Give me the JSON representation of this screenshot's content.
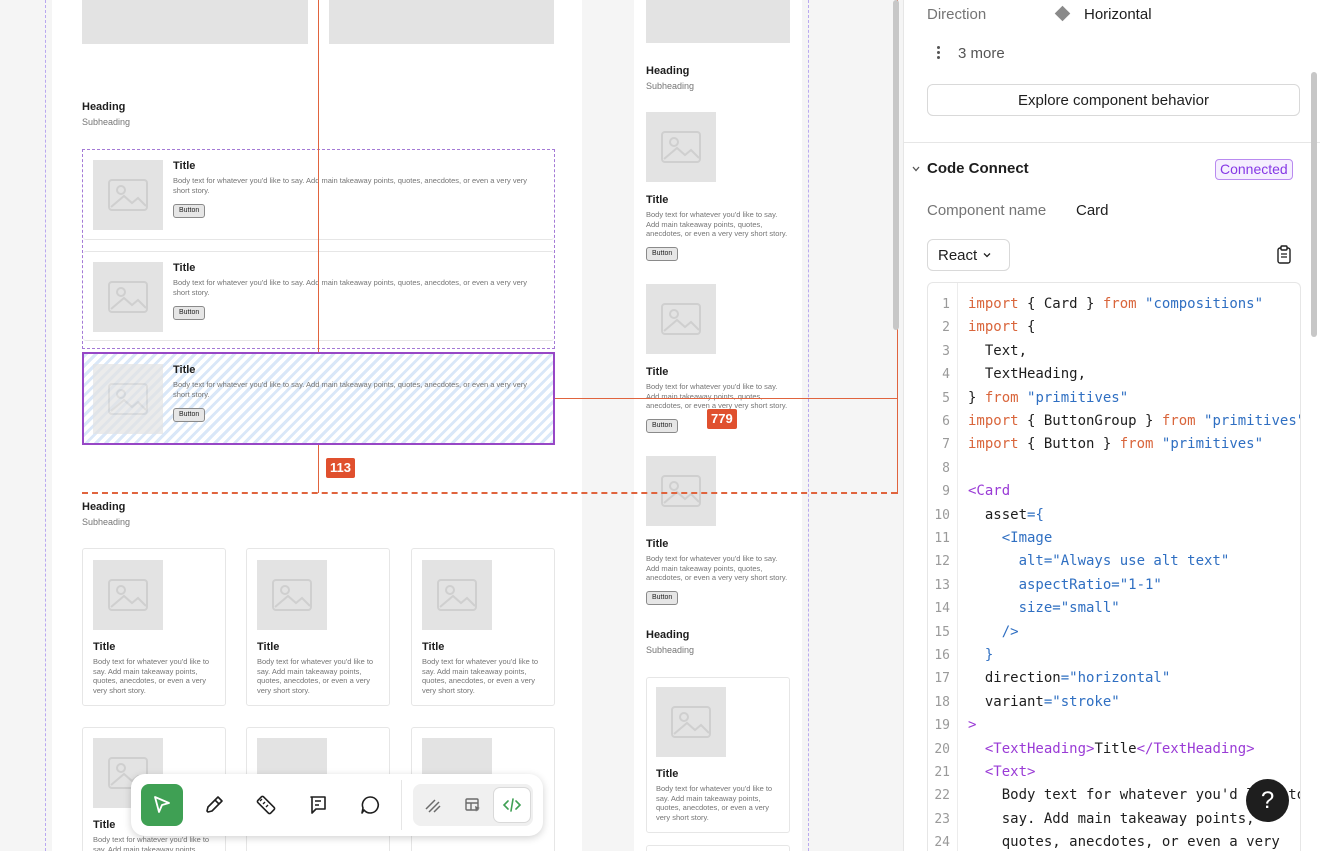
{
  "canvas": {
    "heading": "Heading",
    "subheading": "Subheading",
    "card_title": "Title",
    "card_body": "Body text for whatever you'd like to say. Add main takeaway points, quotes, anecdotes, or even a very very short story.",
    "card_button": "Button",
    "measure_gap": "113",
    "measure_width": "779"
  },
  "toolbar": {
    "tools": [
      "move-tool",
      "pen-tool",
      "measure-tool",
      "annotate-tool",
      "comment-tool"
    ],
    "mode_tools": [
      "draw-mode",
      "design-mode",
      "dev-mode"
    ]
  },
  "panel": {
    "direction_label": "Direction",
    "direction_value": "Horizontal",
    "more_label": "3 more",
    "explore_button": "Explore component behavior",
    "section_title": "Code Connect",
    "status_badge": "Connected",
    "component_name_label": "Component name",
    "component_name_value": "Card",
    "framework": "React",
    "code_lines": [
      [
        {
          "t": "import",
          "c": "kw"
        },
        {
          "t": " { Card } ",
          "c": "p"
        },
        {
          "t": "from",
          "c": "kw"
        },
        {
          "t": " ",
          "c": "p"
        },
        {
          "t": "\"compositions\"",
          "c": "str"
        }
      ],
      [
        {
          "t": "import",
          "c": "kw"
        },
        {
          "t": " {",
          "c": "p"
        }
      ],
      [
        {
          "t": "  Text,",
          "c": "p"
        }
      ],
      [
        {
          "t": "  TextHeading,",
          "c": "p"
        }
      ],
      [
        {
          "t": "} ",
          "c": "p"
        },
        {
          "t": "from",
          "c": "kw"
        },
        {
          "t": " ",
          "c": "p"
        },
        {
          "t": "\"primitives\"",
          "c": "str"
        }
      ],
      [
        {
          "t": "import",
          "c": "kw"
        },
        {
          "t": " { ButtonGroup } ",
          "c": "p"
        },
        {
          "t": "from",
          "c": "kw"
        },
        {
          "t": " ",
          "c": "p"
        },
        {
          "t": "\"primitives\"",
          "c": "str"
        }
      ],
      [
        {
          "t": "import",
          "c": "kw"
        },
        {
          "t": " { Button } ",
          "c": "p"
        },
        {
          "t": "from",
          "c": "kw"
        },
        {
          "t": " ",
          "c": "p"
        },
        {
          "t": "\"primitives\"",
          "c": "str"
        }
      ],
      [],
      [
        {
          "t": "<Card",
          "c": "tag"
        }
      ],
      [
        {
          "t": "  asset",
          "c": "p"
        },
        {
          "t": "={",
          "c": "str"
        }
      ],
      [
        {
          "t": "    <Image",
          "c": "str"
        }
      ],
      [
        {
          "t": "      alt=\"Always use alt text\"",
          "c": "str"
        }
      ],
      [
        {
          "t": "      aspectRatio=\"1-1\"",
          "c": "str"
        }
      ],
      [
        {
          "t": "      size=\"small\"",
          "c": "str"
        }
      ],
      [
        {
          "t": "    />",
          "c": "str"
        }
      ],
      [
        {
          "t": "  }",
          "c": "str"
        }
      ],
      [
        {
          "t": "  direction",
          "c": "p"
        },
        {
          "t": "=\"horizontal\"",
          "c": "str"
        }
      ],
      [
        {
          "t": "  variant",
          "c": "p"
        },
        {
          "t": "=\"stroke\"",
          "c": "str"
        }
      ],
      [
        {
          "t": ">",
          "c": "tag"
        }
      ],
      [
        {
          "t": "  <TextHeading>",
          "c": "tag"
        },
        {
          "t": "Title",
          "c": "p"
        },
        {
          "t": "</TextHeading>",
          "c": "tag"
        }
      ],
      [
        {
          "t": "  <Text>",
          "c": "tag"
        }
      ],
      [
        {
          "t": "    Body text for whatever you'd like to",
          "c": "p"
        }
      ],
      [
        {
          "t": "    say. Add main takeaway points,",
          "c": "p"
        }
      ],
      [
        {
          "t": "    quotes, anecdotes, or even a very",
          "c": "p"
        }
      ]
    ],
    "colors": {
      "kw": "#d9653b",
      "str": "#2f6fc2",
      "tag": "#9a3bd6",
      "p": "#1e1e1e"
    }
  },
  "help_label": "?"
}
